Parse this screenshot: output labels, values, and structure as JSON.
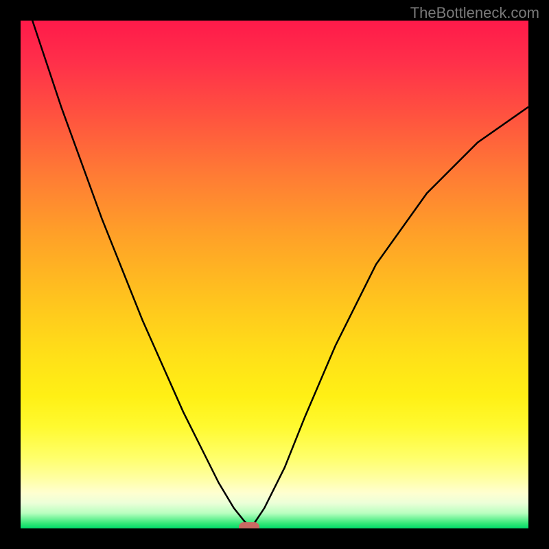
{
  "watermark": "TheBottleneck.com",
  "chart_data": {
    "type": "line",
    "title": "",
    "xlabel": "",
    "ylabel": "",
    "xlim": [
      0,
      100
    ],
    "ylim": [
      0,
      100
    ],
    "series": [
      {
        "name": "curve",
        "x": [
          0,
          4,
          8,
          12,
          16,
          20,
          24,
          28,
          32,
          36,
          39,
          42,
          44,
          45,
          46,
          48,
          52,
          56,
          62,
          70,
          80,
          90,
          100
        ],
        "y": [
          107,
          95,
          83,
          72,
          61,
          51,
          41,
          32,
          23,
          15,
          9,
          4,
          1.5,
          0.5,
          1,
          4,
          12,
          22,
          36,
          52,
          66,
          76,
          83
        ]
      }
    ],
    "marker": {
      "x": 45,
      "y": 0.3
    },
    "gradient_colors": {
      "top": "#ff1a4a",
      "mid": "#ffe018",
      "bottom": "#00d868"
    }
  }
}
